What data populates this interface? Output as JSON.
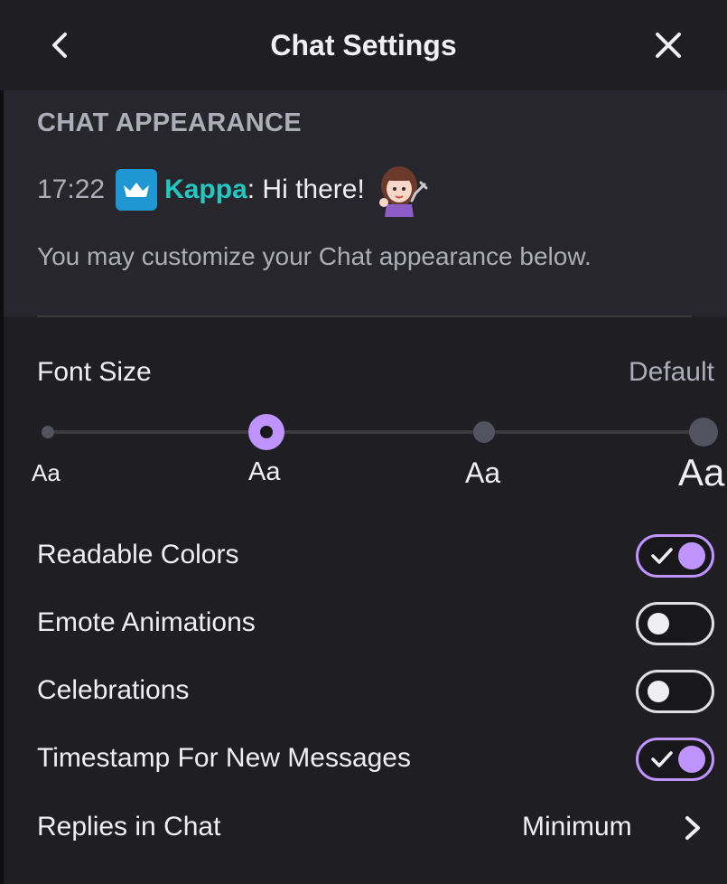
{
  "header": {
    "title": "Chat Settings",
    "back_icon": "chevron-left-icon",
    "close_icon": "close-icon"
  },
  "appearance": {
    "heading": "CHAT APPEARANCE",
    "preview": {
      "timestamp": "17:22",
      "badge_icon": "crown-icon",
      "username": "Kappa",
      "message": ": Hi there!",
      "emote_icon": "emote-icon"
    },
    "hint": "You may customize your Chat appearance below."
  },
  "font_size": {
    "label": "Font Size",
    "value": "Default",
    "options": [
      "Aa",
      "Aa",
      "Aa",
      "Aa"
    ],
    "selected_index": 1
  },
  "toggles": [
    {
      "label": "Readable Colors",
      "on": true
    },
    {
      "label": "Emote Animations",
      "on": false
    },
    {
      "label": "Celebrations",
      "on": false
    },
    {
      "label": "Timestamp For New Messages",
      "on": true
    }
  ],
  "replies": {
    "label": "Replies in Chat",
    "value": "Minimum",
    "icon": "chevron-right-icon"
  },
  "colors": {
    "accent": "#bf94ff",
    "username": "#23c8c0",
    "badge": "#1f97d2"
  }
}
